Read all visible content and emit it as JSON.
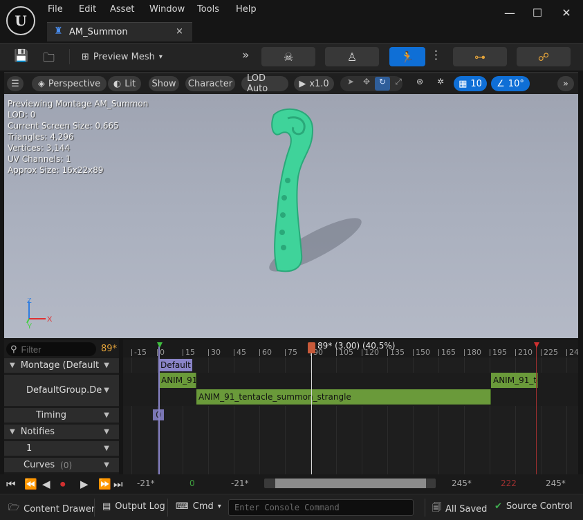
{
  "menu": [
    "File",
    "Edit",
    "Asset",
    "Window",
    "Tools",
    "Help"
  ],
  "tab": {
    "label": "AM_Summon",
    "close": "×"
  },
  "window": {
    "minimize": "—",
    "maximize": "☐",
    "close": "✕"
  },
  "toolbar": {
    "preview_mesh_label": "Preview Mesh"
  },
  "viewport_toolbar": {
    "perspective": "Perspective",
    "lit": "Lit",
    "show": "Show",
    "character": "Character",
    "lod": "LOD Auto",
    "speed": "x1.0",
    "grid_size": "10",
    "rotation_snap": "10°"
  },
  "stats": [
    "Previewing Montage AM_Summon",
    "LOD: 0",
    "Current Screen Size: 0.665",
    "Triangles: 4,296",
    "Vertices: 3,144",
    "UV Channels: 1",
    "Approx Size: 16x22x89"
  ],
  "axis": {
    "z": "Z",
    "x": "X",
    "y": "Y"
  },
  "left_panel": {
    "filter_placeholder": "Filter",
    "frame_counter": "89*",
    "montage_label": "Montage (Default",
    "slot_label": "DefaultGroup.De",
    "timing_label": "Timing",
    "notifies_label": "Notifies",
    "notify_track": "1",
    "curves_label": "Curves",
    "curves_count": "(0)"
  },
  "timeline": {
    "current_frame_label": "89* (3.00) (40.5%)",
    "ticks": [
      "-15",
      "0",
      "15",
      "30",
      "45",
      "60",
      "75",
      "90",
      "105",
      "120",
      "135",
      "150",
      "165",
      "180",
      "195",
      "210",
      "225",
      "24"
    ],
    "section_default": "Default",
    "segments": [
      "ANIM_91",
      "ANIM_91_tentacle_summon_strangle",
      "ANIM_91_te"
    ],
    "timing_marker": "0"
  },
  "playback": {
    "view_start": "-21*",
    "play_start": "0",
    "range_start": "-21*",
    "range_end": "245*",
    "play_end": "222",
    "view_end": "245*"
  },
  "status_bar": {
    "content_drawer": "Content Drawer",
    "output_log": "Output Log",
    "cmd": "Cmd",
    "console_placeholder": "Enter Console Command",
    "all_saved": "All Saved",
    "source_control": "Source Control"
  },
  "colors": {
    "accent": "#0f6fd6",
    "mesh": "#3fd39a",
    "segment": "#6a9a3a",
    "section": "#8a84c8",
    "frame_counter": "#e2a23a",
    "playhead": "#c85a3a"
  }
}
